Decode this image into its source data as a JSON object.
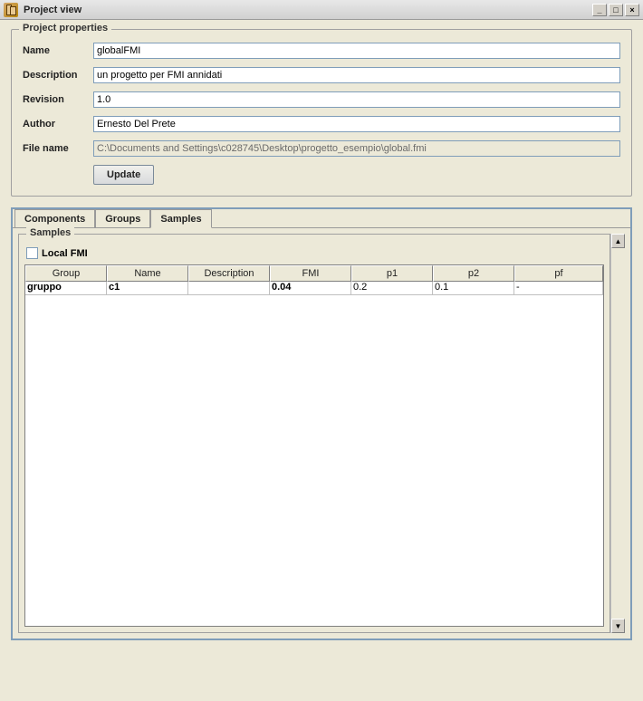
{
  "window": {
    "title": "Project view"
  },
  "properties": {
    "legend": "Project properties",
    "labels": {
      "name": "Name",
      "description": "Description",
      "revision": "Revision",
      "author": "Author",
      "filename": "File name"
    },
    "values": {
      "name": "globalFMI",
      "description": "un progetto per FMI annidati",
      "revision": "1.0",
      "author": "Ernesto Del Prete",
      "filename": "C:\\Documents and Settings\\c028745\\Desktop\\progetto_esempio\\global.fmi"
    },
    "update_label": "Update"
  },
  "tabs": {
    "items": [
      "Components",
      "Groups",
      "Samples"
    ],
    "active_index": 2
  },
  "samples": {
    "legend": "Samples",
    "checkbox_label": "Local FMI",
    "checkbox_checked": false,
    "columns": [
      "Group",
      "Name",
      "Description",
      "FMI",
      "p1",
      "p2",
      "pf"
    ],
    "rows": [
      {
        "group": "gruppo",
        "name": "c1",
        "description": "",
        "fmi": "0.04",
        "p1": "0.2",
        "p2": "0.1",
        "pf": "-"
      }
    ]
  }
}
